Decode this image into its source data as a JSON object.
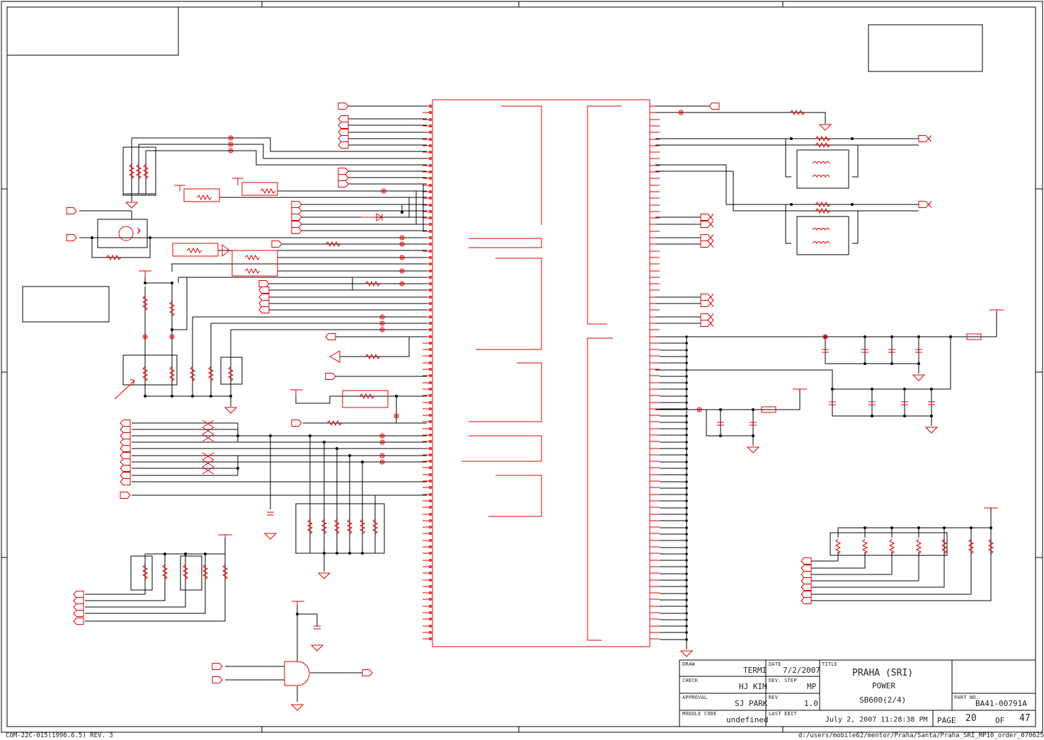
{
  "title_block": {
    "draw_label": "DRAW",
    "draw_value": "TERMI",
    "date_label": "DATE",
    "date_value": "7/2/2007",
    "title_label": "TITLE",
    "title_line1": "PRAHA (SRI)",
    "title_line2": "POWER",
    "title_line3": "SB600(2/4)",
    "check_label": "CHECK",
    "check_value": "HJ KIM",
    "dev_step_label": "DEV. STEP",
    "dev_step_value": "MP",
    "approval_label": "APPROVAL",
    "approval_value": "SJ PARK",
    "rev_label": "REV",
    "rev_value": "1.0",
    "part_no_label": "PART NO.",
    "part_no_value": "BA41-00791A",
    "module_code_label": "MODULE CODE",
    "module_code_value": "undefined",
    "last_edit_label": "LAST EDIT",
    "last_edit_value": "July 2, 2007  11:28:38 PM",
    "page_label": "PAGE",
    "page_value": "20",
    "of_label": "OF",
    "of_value": "47"
  },
  "footer": {
    "form_code": "COM-22C-015(1996.6.5) REV. 3",
    "file_path": "d:/users/mobile62/mentor/Praha/Santa/Praha_SRI_MP10_order_070625"
  },
  "colors": {
    "frame": "#000000",
    "symbol": "#e00000"
  }
}
